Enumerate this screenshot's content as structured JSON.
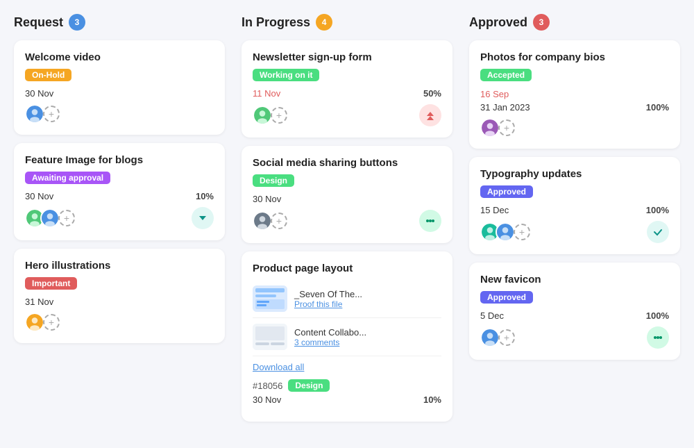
{
  "columns": [
    {
      "id": "request",
      "title": "Request",
      "badge": "3",
      "badge_color": "badge-blue",
      "cards": [
        {
          "id": "welcome-video",
          "title": "Welcome video",
          "tag": "On-Hold",
          "tag_class": "tag-onhold",
          "date": "30 Nov",
          "date_red": false,
          "avatars": [
            "av1"
          ],
          "show_percent": false,
          "percent": "",
          "icon": null
        },
        {
          "id": "feature-image",
          "title": "Feature Image for blogs",
          "tag": "Awaiting approval",
          "tag_class": "tag-awaiting",
          "date": "30 Nov",
          "date_red": false,
          "avatars": [
            "av2",
            "av1"
          ],
          "show_percent": true,
          "percent": "10%",
          "icon": "teal-down"
        },
        {
          "id": "hero-illustrations",
          "title": "Hero illustrations",
          "tag": "Important",
          "tag_class": "tag-important",
          "date": "31 Nov",
          "date_red": false,
          "avatars": [
            "av3"
          ],
          "show_percent": false,
          "percent": "",
          "icon": null
        }
      ]
    },
    {
      "id": "in-progress",
      "title": "In Progress",
      "badge": "4",
      "badge_color": "badge-orange",
      "cards": [
        {
          "id": "newsletter-form",
          "title": "Newsletter sign-up form",
          "tag": "Working on it",
          "tag_class": "tag-working",
          "date": "11 Nov",
          "date_red": true,
          "avatars": [
            "av2"
          ],
          "show_percent": true,
          "percent": "50%",
          "icon": "red-up"
        },
        {
          "id": "social-media",
          "title": "Social media sharing buttons",
          "tag": "Design",
          "tag_class": "tag-design",
          "date": "30 Nov",
          "date_red": false,
          "avatars": [
            "av4"
          ],
          "show_percent": false,
          "percent": "",
          "icon": "green-dots"
        },
        {
          "id": "product-page",
          "title": "Product page layout",
          "tag": null,
          "tag_class": "",
          "date": "30 Nov",
          "date_red": false,
          "avatars": [],
          "show_percent": true,
          "percent": "10%",
          "icon": null,
          "has_files": true,
          "files": [
            {
              "name": "_Seven Of The...",
              "action": "Proof this file"
            },
            {
              "name": "Content Collabo...",
              "action": "3 comments"
            }
          ],
          "ticket": "#18056",
          "ticket_tag": "Design"
        }
      ]
    },
    {
      "id": "approved",
      "title": "Approved",
      "badge": "3",
      "badge_color": "badge-red",
      "cards": [
        {
          "id": "photos-bios",
          "title": "Photos for company bios",
          "tag": "Accepted",
          "tag_class": "tag-accepted",
          "date": "16 Sep",
          "date_red": true,
          "date2": "31 Jan 2023",
          "avatars": [
            "av5"
          ],
          "show_percent": true,
          "percent": "100%",
          "icon": null
        },
        {
          "id": "typography",
          "title": "Typography updates",
          "tag": "Approved",
          "tag_class": "tag-approved",
          "date": "15 Dec",
          "date_red": false,
          "avatars": [
            "av6",
            "av1"
          ],
          "show_percent": true,
          "percent": "100%",
          "icon": "teal-check"
        },
        {
          "id": "new-favicon",
          "title": "New favicon",
          "tag": "Approved",
          "tag_class": "tag-approved",
          "date": "5 Dec",
          "date_red": false,
          "avatars": [
            "av1"
          ],
          "show_percent": true,
          "percent": "100%",
          "icon": "green-dots2"
        }
      ]
    }
  ],
  "labels": {
    "plus": "+",
    "download_all": "Download all"
  }
}
